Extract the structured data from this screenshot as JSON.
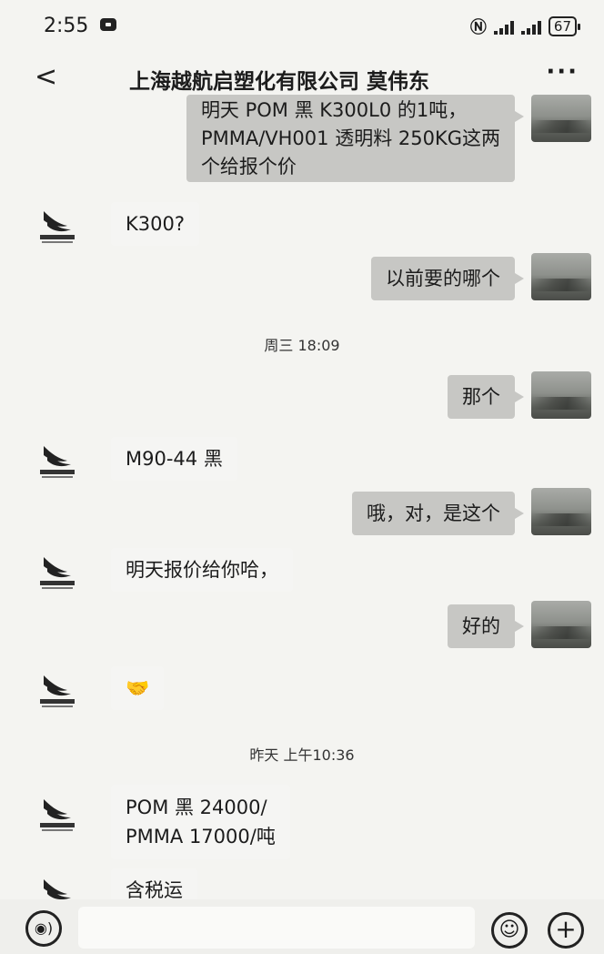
{
  "status_bar": {
    "time": "2:55",
    "battery": "67"
  },
  "header": {
    "title": "上海越航启塑化有限公司 莫伟东"
  },
  "messages": [
    {
      "line1": "明天 POM 黑 K300L0 的1吨，",
      "line2": "PMMA/VH001 透明料 250KG这两",
      "line3": "个给报个价"
    },
    {
      "text": "K300?"
    },
    {
      "text": "以前要的哪个"
    },
    {
      "text": "那个"
    },
    {
      "text": "M90-44 黑"
    },
    {
      "text": "哦，对，是这个"
    },
    {
      "text": "明天报价给你哈，"
    },
    {
      "text": "好的"
    },
    {
      "text": "🤝"
    },
    {
      "line1": "POM 黑 24000/",
      "line2": "PMMA 17000/吨"
    },
    {
      "text": "含税运"
    }
  ],
  "timestamps": [
    "周三 18:09",
    "昨天 上午10:36"
  ],
  "icons": {
    "back": "chevron-left-icon",
    "more": "more-dots-icon",
    "voice": "voice-icon",
    "emoji": "emoji-icon",
    "plus": "plus-icon"
  }
}
